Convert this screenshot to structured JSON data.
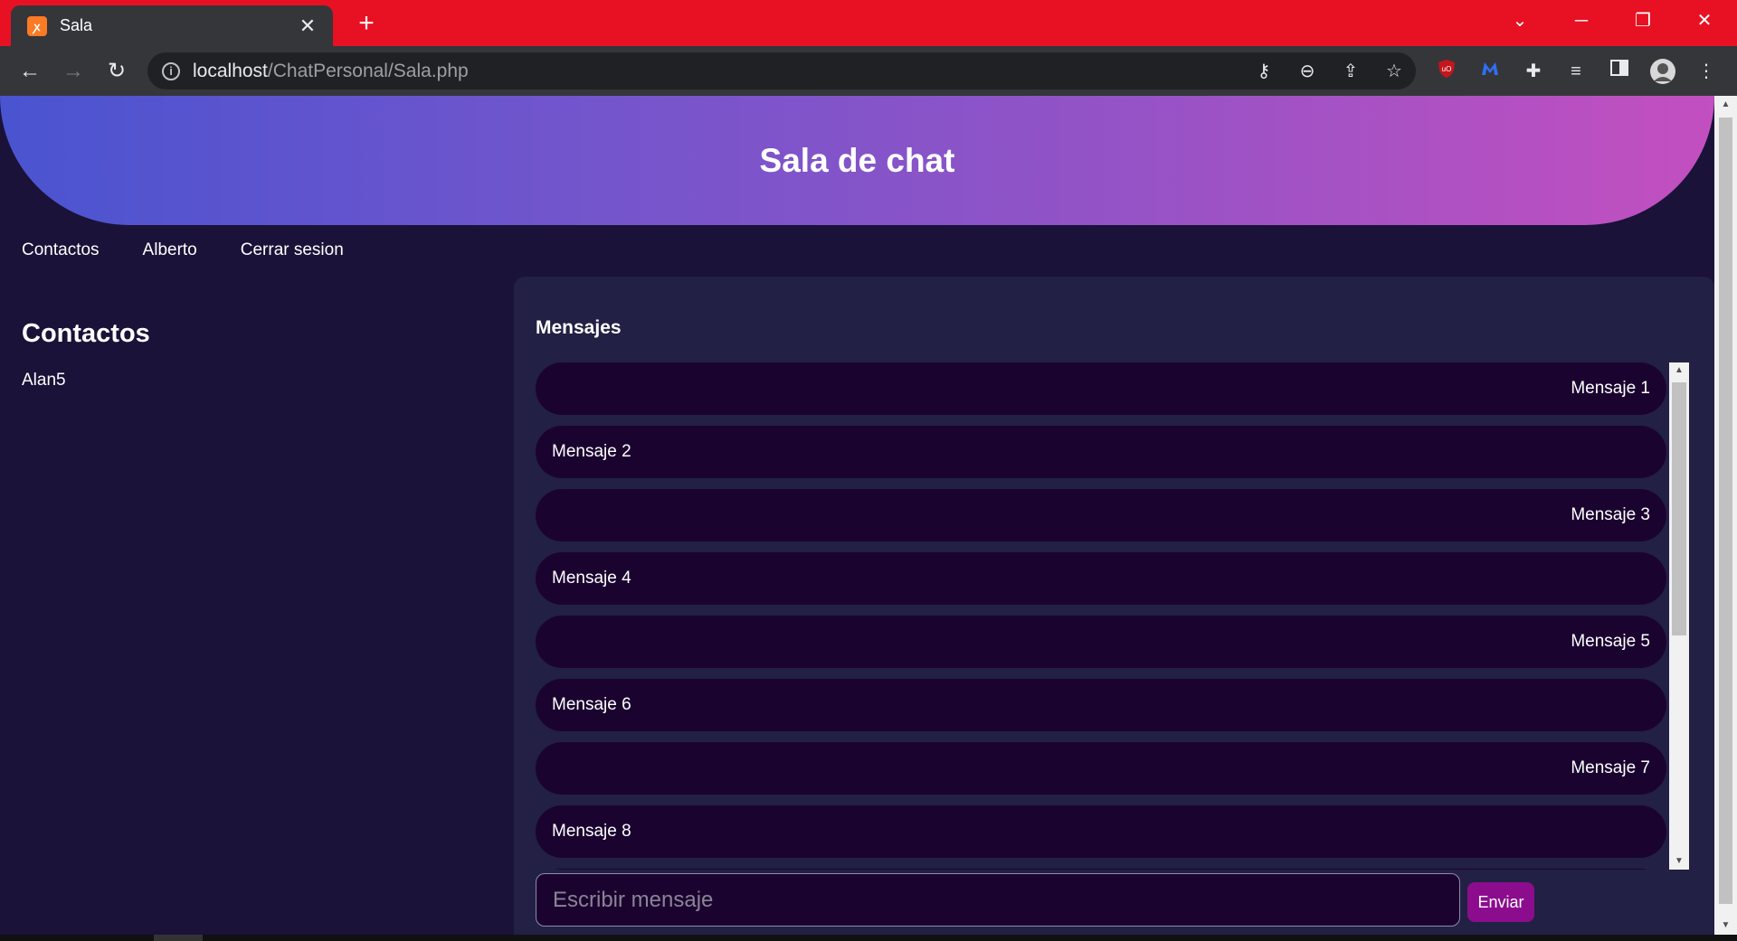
{
  "browser": {
    "tab_title": "Sala",
    "tab_close": "✕",
    "new_tab": "+",
    "url_host": "localhost",
    "url_path": "/ChatPersonal/Sala.php",
    "info_icon": "i"
  },
  "page": {
    "header_title": "Sala de chat",
    "nav": [
      "Contactos",
      "Alberto",
      "Cerrar sesion"
    ],
    "contacts": {
      "title": "Contactos",
      "items": [
        "Alan5"
      ]
    },
    "chat": {
      "title": "Mensajes",
      "messages": [
        {
          "text": "Mensaje 1",
          "align": "right"
        },
        {
          "text": "Mensaje 2",
          "align": "left"
        },
        {
          "text": "Mensaje 3",
          "align": "right"
        },
        {
          "text": "Mensaje 4",
          "align": "left"
        },
        {
          "text": "Mensaje 5",
          "align": "right"
        },
        {
          "text": "Mensaje 6",
          "align": "left"
        },
        {
          "text": "Mensaje 7",
          "align": "right"
        },
        {
          "text": "Mensaje 8",
          "align": "left"
        }
      ],
      "input_placeholder": "Escribir mensaje",
      "send_label": "Enviar"
    }
  },
  "colors": {
    "tabbar": "#e81123",
    "page_bg": "#1a1238",
    "panel_bg": "#222044",
    "message_bg": "#1b0330",
    "send_button": "#8b0d8e"
  }
}
